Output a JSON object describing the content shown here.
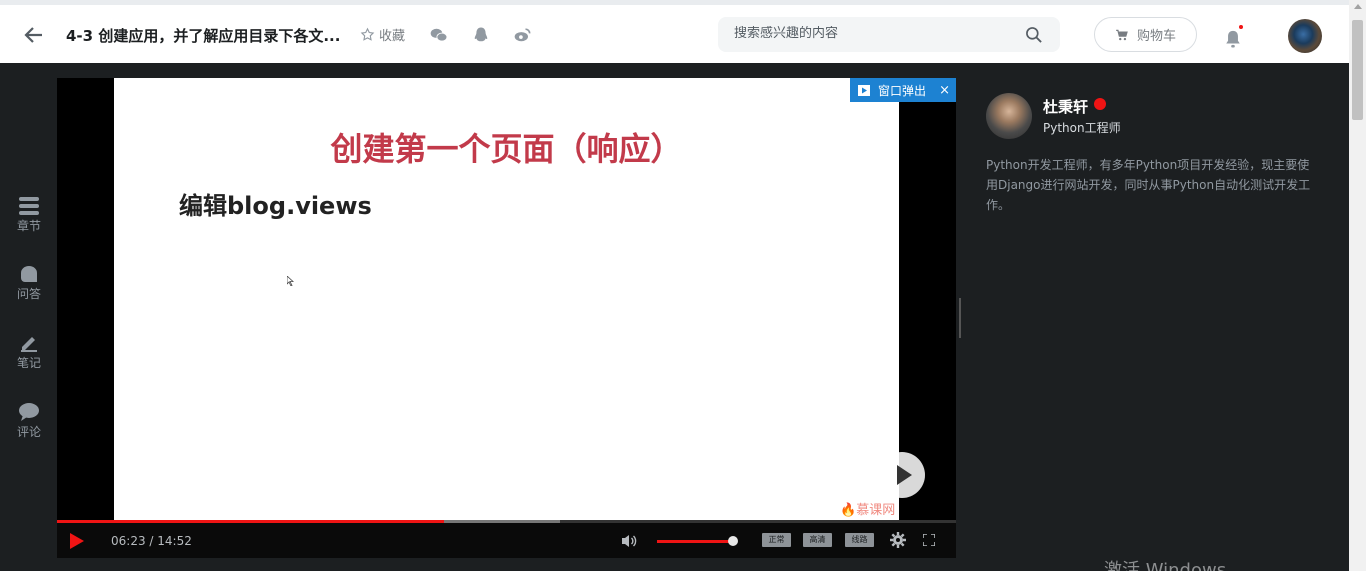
{
  "header": {
    "title": "4-3 创建应用，并了解应用目录下各文...",
    "favorite_label": "收藏",
    "search_placeholder": "搜索感兴趣的内容",
    "cart_label": "购物车"
  },
  "sidebar": {
    "items": [
      {
        "label": "章节",
        "icon": "chapter-icon"
      },
      {
        "label": "问答",
        "icon": "qa-icon"
      },
      {
        "label": "笔记",
        "icon": "note-icon"
      },
      {
        "label": "评论",
        "icon": "comment-icon"
      }
    ]
  },
  "video": {
    "slide_title": "创建第一个页面（响应）",
    "slide_subtitle": "编辑blog.views",
    "watermark": "慕课网",
    "popout_label": "窗口弹出",
    "close_label": "×",
    "current_time": "06:23",
    "total_time": "14:52",
    "time_display": "06:23 / 14:52",
    "progress_fraction": 0.43,
    "buffered_fraction": 0.56,
    "volume_fraction": 0.95,
    "quality_options": [
      "正常",
      "高清",
      "线路"
    ]
  },
  "teacher": {
    "name": "杜秉轩",
    "title": "Python工程师",
    "description": "Python开发工程师，有多年Python项目开发经验，现主要使用Django进行网站开发，同时从事Python自动化测试开发工作。"
  },
  "system": {
    "activate_text": "激活 Windows"
  },
  "colors": {
    "accent_red": "#f01414",
    "slide_title_red": "#c23a4a",
    "popout_blue": "#1d82d2",
    "dark_bg": "#1c1f21"
  }
}
